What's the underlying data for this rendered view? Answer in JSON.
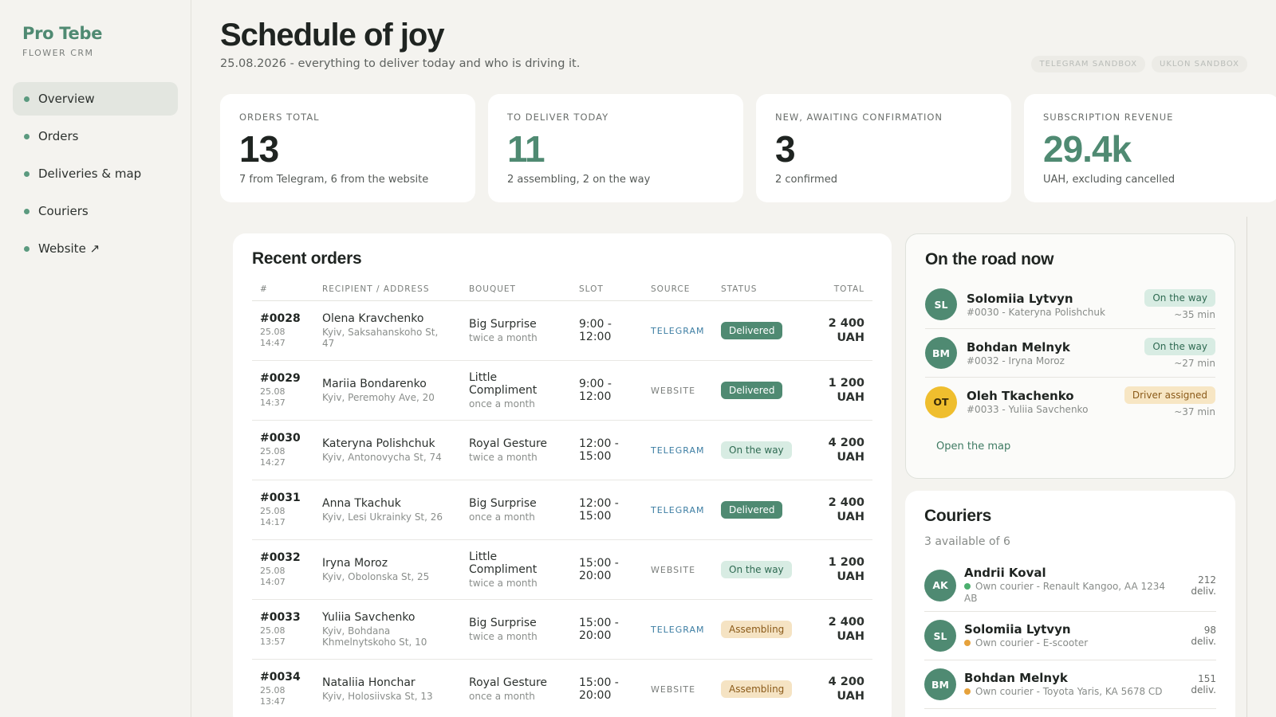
{
  "brand": {
    "name": "Pro Tebe",
    "subtitle": "FLOWER CRM"
  },
  "nav": [
    {
      "label": "Overview",
      "active": true
    },
    {
      "label": "Orders"
    },
    {
      "label": "Deliveries & map"
    },
    {
      "label": "Couriers"
    },
    {
      "label": "Website ↗"
    }
  ],
  "header": {
    "title": "Schedule of joy",
    "subtitle": "25.08.2026 - everything to deliver today and who is driving it.",
    "sandbox_telegram": "TELEGRAM SANDBOX",
    "sandbox_uklon": "UKLON SANDBOX"
  },
  "stats": [
    {
      "label": "ORDERS TOTAL",
      "value": "13",
      "note": "7 from Telegram, 6 from the website"
    },
    {
      "label": "TO DELIVER TODAY",
      "value": "11",
      "note": "2 assembling, 2 on the way"
    },
    {
      "label": "NEW, AWAITING CONFIRMATION",
      "value": "3",
      "note": "2 confirmed"
    },
    {
      "label": "SUBSCRIPTION REVENUE",
      "value": "29.4k",
      "note": "UAH, excluding cancelled"
    }
  ],
  "recent": {
    "title": "Recent orders",
    "columns": [
      "#",
      "RECIPIENT / ADDRESS",
      "BOUQUET",
      "SLOT",
      "SOURCE",
      "STATUS",
      "TOTAL"
    ],
    "rows": [
      {
        "id": "#0028",
        "date": "25.08 14:47",
        "name": "Olena Kravchenko",
        "address": "Kyiv, Saksahanskoho St, 47",
        "bouquet": "Big Surprise",
        "freq": "twice a month",
        "slot": "9:00 - 12:00",
        "source": "TELEGRAM",
        "status": "Delivered",
        "total": "2 400 UAH"
      },
      {
        "id": "#0029",
        "date": "25.08 14:37",
        "name": "Mariia Bondarenko",
        "address": "Kyiv, Peremohy Ave, 20",
        "bouquet": "Little Compliment",
        "freq": "once a month",
        "slot": "9:00 - 12:00",
        "source": "WEBSITE",
        "status": "Delivered",
        "total": "1 200 UAH"
      },
      {
        "id": "#0030",
        "date": "25.08 14:27",
        "name": "Kateryna Polishchuk",
        "address": "Kyiv, Antonovycha St, 74",
        "bouquet": "Royal Gesture",
        "freq": "twice a month",
        "slot": "12:00 - 15:00",
        "source": "TELEGRAM",
        "status": "On the way",
        "total": "4 200 UAH"
      },
      {
        "id": "#0031",
        "date": "25.08 14:17",
        "name": "Anna Tkachuk",
        "address": "Kyiv, Lesi Ukrainky St, 26",
        "bouquet": "Big Surprise",
        "freq": "once a month",
        "slot": "12:00 - 15:00",
        "source": "TELEGRAM",
        "status": "Delivered",
        "total": "2 400 UAH"
      },
      {
        "id": "#0032",
        "date": "25.08 14:07",
        "name": "Iryna Moroz",
        "address": "Kyiv, Obolonska St, 25",
        "bouquet": "Little Compliment",
        "freq": "twice a month",
        "slot": "15:00 - 20:00",
        "source": "WEBSITE",
        "status": "On the way",
        "total": "1 200 UAH"
      },
      {
        "id": "#0033",
        "date": "25.08 13:57",
        "name": "Yuliia Savchenko",
        "address": "Kyiv, Bohdana Khmelnytskoho St, 10",
        "bouquet": "Big Surprise",
        "freq": "twice a month",
        "slot": "15:00 - 20:00",
        "source": "TELEGRAM",
        "status": "Assembling",
        "total": "2 400 UAH"
      },
      {
        "id": "#0034",
        "date": "25.08 13:47",
        "name": "Nataliia Honchar",
        "address": "Kyiv, Holosiivska St, 13",
        "bouquet": "Royal Gesture",
        "freq": "once a month",
        "slot": "15:00 - 20:00",
        "source": "WEBSITE",
        "status": "Assembling",
        "total": "4 200 UAH"
      }
    ]
  },
  "road": {
    "title": "On the road now",
    "items": [
      {
        "initials": "SL",
        "name": "Solomiia Lytvyn",
        "order": "#0030 - Kateryna Polishchuk",
        "status": "On the way",
        "eta": "~35 min"
      },
      {
        "initials": "BM",
        "name": "Bohdan Melnyk",
        "order": "#0032 - Iryna Moroz",
        "status": "On the way",
        "eta": "~27 min"
      },
      {
        "initials": "OT",
        "name": "Oleh Tkachenko",
        "order": "#0033 - Yuliia Savchenko",
        "status": "Driver assigned",
        "eta": "~37 min"
      }
    ],
    "map_link": "Open the map"
  },
  "couriers": {
    "title": "Couriers",
    "subtitle": "3 available of 6",
    "items": [
      {
        "initials": "AK",
        "name": "Andrii Koval",
        "desc": "Own courier - Renault Kangoo, AA 1234 AB",
        "count": "212 deliv."
      },
      {
        "initials": "SL",
        "name": "Solomiia Lytvyn",
        "desc": "Own courier - E-scooter",
        "count": "98 deliv."
      },
      {
        "initials": "BM",
        "name": "Bohdan Melnyk",
        "desc": "Own courier - Toyota Yaris, KA 5678 CD",
        "count": "151 deliv."
      }
    ]
  }
}
